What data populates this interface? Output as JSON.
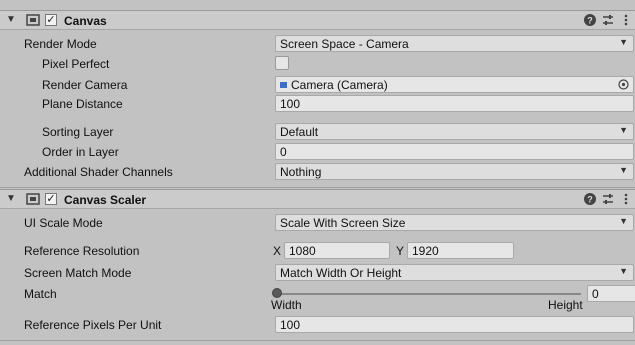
{
  "canvas": {
    "title": "Canvas",
    "enabled": true,
    "render_mode": {
      "label": "Render Mode",
      "value": "Screen Space - Camera"
    },
    "pixel_perfect": {
      "label": "Pixel Perfect",
      "checked": false
    },
    "render_camera": {
      "label": "Render Camera",
      "value": "Camera (Camera)"
    },
    "plane_distance": {
      "label": "Plane Distance",
      "value": "100"
    },
    "sorting_layer": {
      "label": "Sorting Layer",
      "value": "Default"
    },
    "order_in_layer": {
      "label": "Order in Layer",
      "value": "0"
    },
    "shader_channels": {
      "label": "Additional Shader Channels",
      "value": "Nothing"
    }
  },
  "canvas_scaler": {
    "title": "Canvas Scaler",
    "enabled": true,
    "ui_scale_mode": {
      "label": "UI Scale Mode",
      "value": "Scale With Screen Size"
    },
    "reference_resolution": {
      "label": "Reference Resolution",
      "x_label": "X",
      "x_value": "1080",
      "y_label": "Y",
      "y_value": "1920"
    },
    "screen_match_mode": {
      "label": "Screen Match Mode",
      "value": "Match Width Or Height"
    },
    "match": {
      "label": "Match",
      "value": "0",
      "left_caption": "Width",
      "right_caption": "Height"
    },
    "ref_pixels_per_unit": {
      "label": "Reference Pixels Per Unit",
      "value": "100"
    }
  },
  "icons": {
    "foldout": "triangle-down-icon",
    "component": "canvas-component-icon",
    "help": "help-icon",
    "presets": "presets-icon",
    "menu": "kebab-menu-icon",
    "camera": "camera-icon",
    "object_picker": "object-picker-icon"
  },
  "colors": {
    "panel": "#c2c2c2",
    "header": "#cbcbcb",
    "field": "#e6e6e6",
    "camera_icon": "#3a6fc4"
  }
}
